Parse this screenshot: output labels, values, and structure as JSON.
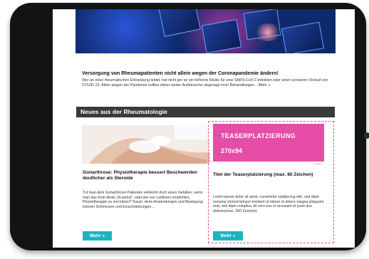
{
  "teaser_article": {
    "headline": "Versorgung von Rheumapatienten nicht allein wegen der Coronapandemie ändern!",
    "body": "Wer an einer rheumatischen Erkrankung leidet, hat nicht per se ein höheres Risiko für eine SARS-CoV-2-Infektion oder einen schweren Verlauf von COVID-19. Allein wegen der Pandemie sollten daher weder Arztbesuche abgesagt noch Behandlungen...",
    "more_link": "Mehr »"
  },
  "section": {
    "title": "Neues aus der Rheumatologie"
  },
  "article_left": {
    "title": "Gonarthrose: Physiotherapie bessert Beschwerden deutlicher als Steroide",
    "body": "Tut man dem Gonarthrose-Patienten vielleicht doch einen Gefallen, wenn man das Knie direkt „fit-spritzt“, statt wie von Leitlinien empfohlen, Physiotherapie zu verordnen? Kaum, denn Anwendungen und Bewegung können Schmerzen und Einschränkungen...",
    "button": "Mehr »"
  },
  "teaser_ad": {
    "line1": "TEASERPLATZIERUNG",
    "line2": "270x94",
    "label": "Anzeige",
    "title": "Titel der Teaserplatzierung (max. 80 Zeichen)",
    "body": "Lorem ipsum dolor sit amet, consetetur sadipscing elitr, sed diam nonumy eirmod tempor invidunt ut labore et dolore magna aliquyam erat, sed diam voluptua. At vero eos et accusam et justo duo dolores(max. 250 Zeichen)",
    "button": "Mehr »",
    "accent": "#e54da6",
    "border": "#e7558f"
  },
  "colors": {
    "button": "#1bb4bf",
    "section_bar": "#3a3a3a"
  }
}
